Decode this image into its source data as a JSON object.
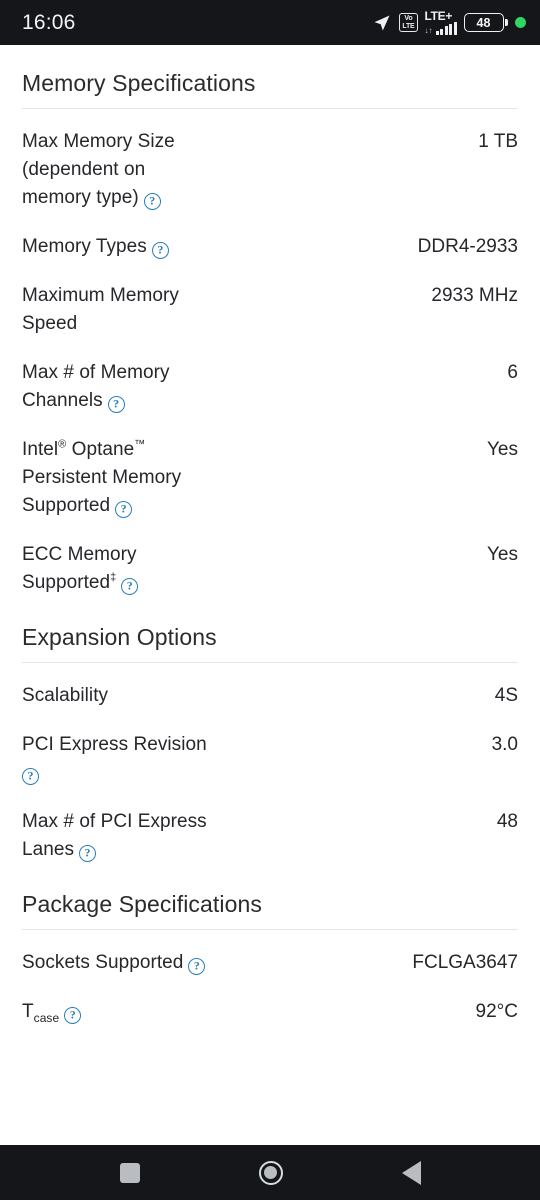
{
  "status_bar": {
    "clock": "16:06",
    "volte_top": "Vo",
    "volte_bottom": "LTE",
    "network": "LTE+",
    "data_arrows": "↓↑",
    "battery_level": "48",
    "icons": [
      "location-arrow-icon",
      "volte-icon",
      "signal-bars-icon",
      "battery-icon",
      "recording-dot-icon"
    ]
  },
  "sections": [
    {
      "title": "Memory Specifications",
      "rows": [
        {
          "label": "Max Memory Size (dependent on memory type)",
          "help": true,
          "value": "1 TB"
        },
        {
          "label": "Memory Types",
          "help": true,
          "value": "DDR4-2933"
        },
        {
          "label": "Maximum Memory Speed",
          "help": false,
          "value": "2933 MHz"
        },
        {
          "label": "Max # of Memory Channels",
          "help": true,
          "value": "6"
        },
        {
          "label": "Intel® Optane™ Persistent Memory Supported",
          "help": true,
          "value": "Yes"
        },
        {
          "label": "ECC Memory Supported ‡",
          "help": true,
          "value": "Yes"
        }
      ]
    },
    {
      "title": "Expansion Options",
      "rows": [
        {
          "label": "Scalability",
          "help": false,
          "value": "4S"
        },
        {
          "label": "PCI Express Revision",
          "help": true,
          "value": "3.0"
        },
        {
          "label": "Max # of PCI Express Lanes",
          "help": true,
          "value": "48"
        }
      ]
    },
    {
      "title": "Package Specifications",
      "rows": [
        {
          "label": "Sockets Supported",
          "help": true,
          "value": "FCLGA3647"
        },
        {
          "label": "T_case",
          "help": true,
          "value": "92°C"
        }
      ]
    }
  ],
  "labels": {
    "s0_r0_a": "Max Memory Size",
    "s0_r0_b": "(dependent on",
    "s0_r0_c": "memory type)",
    "s0_r0_value": "1 TB",
    "s0_r1": "Memory Types",
    "s0_r1_value": "DDR4-2933",
    "s0_r2_a": "Maximum Memory",
    "s0_r2_b": "Speed",
    "s0_r2_value": "2933 MHz",
    "s0_r3_a": "Max # of Memory",
    "s0_r3_b": "Channels",
    "s0_r3_value": "6",
    "s0_r4_a": "Intel",
    "s0_r4_sup1": "®",
    "s0_r4_b": " Optane",
    "s0_r4_sup2": "™",
    "s0_r4_c": "Persistent Memory",
    "s0_r4_d": "Supported",
    "s0_r4_value": "Yes",
    "s0_r5_a": "ECC Memory",
    "s0_r5_b": "Supported",
    "s0_r5_sup": "‡",
    "s0_r5_value": "Yes",
    "s1_r0": "Scalability",
    "s1_r0_value": "4S",
    "s1_r1": "PCI Express Revision",
    "s1_r1_value": "3.0",
    "s1_r2_a": "Max # of PCI Express",
    "s1_r2_b": "Lanes",
    "s1_r2_value": "48",
    "s2_r0": "Sockets Supported",
    "s2_r0_value": "FCLGA3647",
    "s2_r1": "T",
    "s2_r1_sub": "case",
    "s2_r1_value": "92°C"
  },
  "section_titles": {
    "memory": "Memory Specifications",
    "expansion": "Expansion Options",
    "package": "Package Specifications"
  },
  "help_glyph": "?",
  "nav_bar": {
    "recents": "recents-button",
    "home": "home-button",
    "back": "back-button"
  },
  "colors": {
    "help_icon": "#2a7fb8",
    "text": "#26272b",
    "heading": "#2b2b2b",
    "divider": "#e6e6e6",
    "statusbar_bg": "#14161a",
    "green_dot": "#2fd65f"
  }
}
